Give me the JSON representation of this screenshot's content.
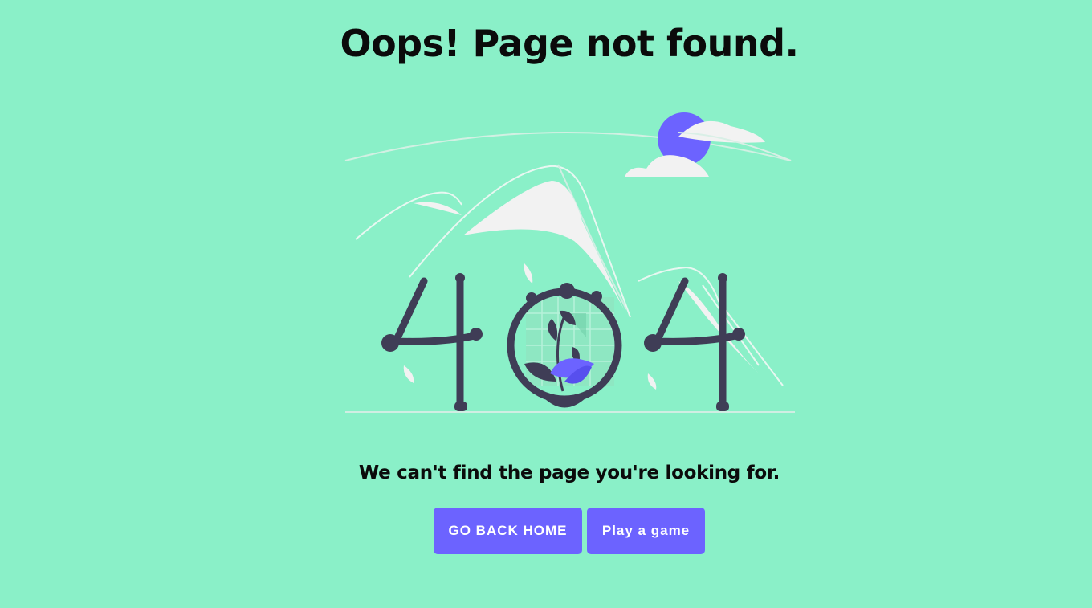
{
  "page": {
    "title": "Oops! Page not found.",
    "subtitle": "We can't find the page you're looking for."
  },
  "actions": {
    "home_label": "GO BACK HOME",
    "game_label": "Play a game"
  },
  "illustration": {
    "icon": "404-mountains-plant-illustration"
  },
  "colors": {
    "background": "#8af0c8",
    "accent": "#6c63ff",
    "ink": "#3f3d56",
    "cloud": "#f2f2f2"
  }
}
